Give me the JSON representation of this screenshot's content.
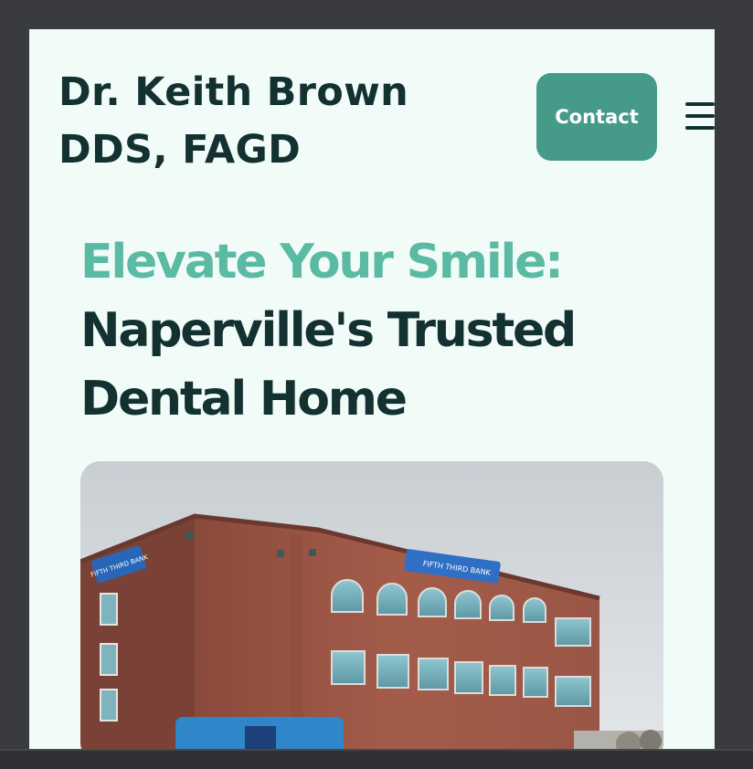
{
  "header": {
    "brand_line1": "Dr. Keith Brown",
    "brand_line2": "DDS, FAGD",
    "contact_label": "Contact",
    "menu_icon": "hamburger-menu-icon"
  },
  "hero": {
    "heading_accent": "Elevate Your Smile:",
    "heading_line2": "Naperville's Trusted",
    "heading_line3": "Dental Home",
    "image_signs": {
      "sign_main": "FIFTH THIRD BANK",
      "sign_side": "FIFTH THIRD BANK"
    }
  },
  "colors": {
    "page_background": "#f1fcf9",
    "frame": "#3a3b3e",
    "brand_text": "#133131",
    "accent": "#5bbaa3",
    "button": "#469a8a"
  }
}
